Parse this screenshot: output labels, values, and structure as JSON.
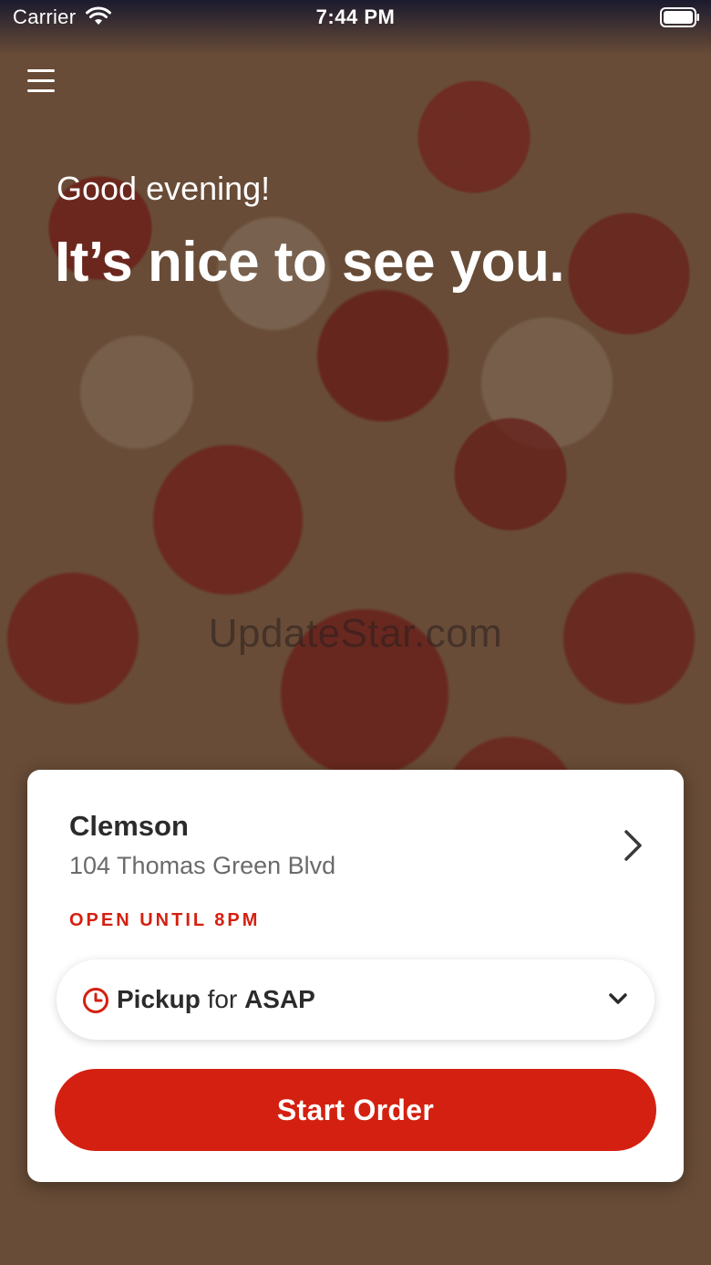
{
  "status_bar": {
    "carrier": "Carrier",
    "time": "7:44 PM",
    "wifi_icon": "wifi-icon",
    "battery_icon": "battery-icon"
  },
  "menu": {
    "icon": "hamburger-menu-icon"
  },
  "hero": {
    "greeting": "Good evening!",
    "headline": "It’s nice to see you.",
    "watermark": "UpdateStar.com"
  },
  "store": {
    "name": "Clemson",
    "address": "104 Thomas Green Blvd",
    "hours": "OPEN UNTIL 8PM",
    "chevron_icon": "chevron-right-icon"
  },
  "order_type": {
    "icon": "clock-icon",
    "mode": "Pickup",
    "connector": "for",
    "time": "ASAP",
    "dropdown_icon": "chevron-down-icon"
  },
  "actions": {
    "start_order": "Start Order"
  },
  "colors": {
    "accent": "#d42010",
    "card_background": "#ffffff",
    "text_primary": "#2b2b2b",
    "text_secondary": "#6b6b6b"
  }
}
